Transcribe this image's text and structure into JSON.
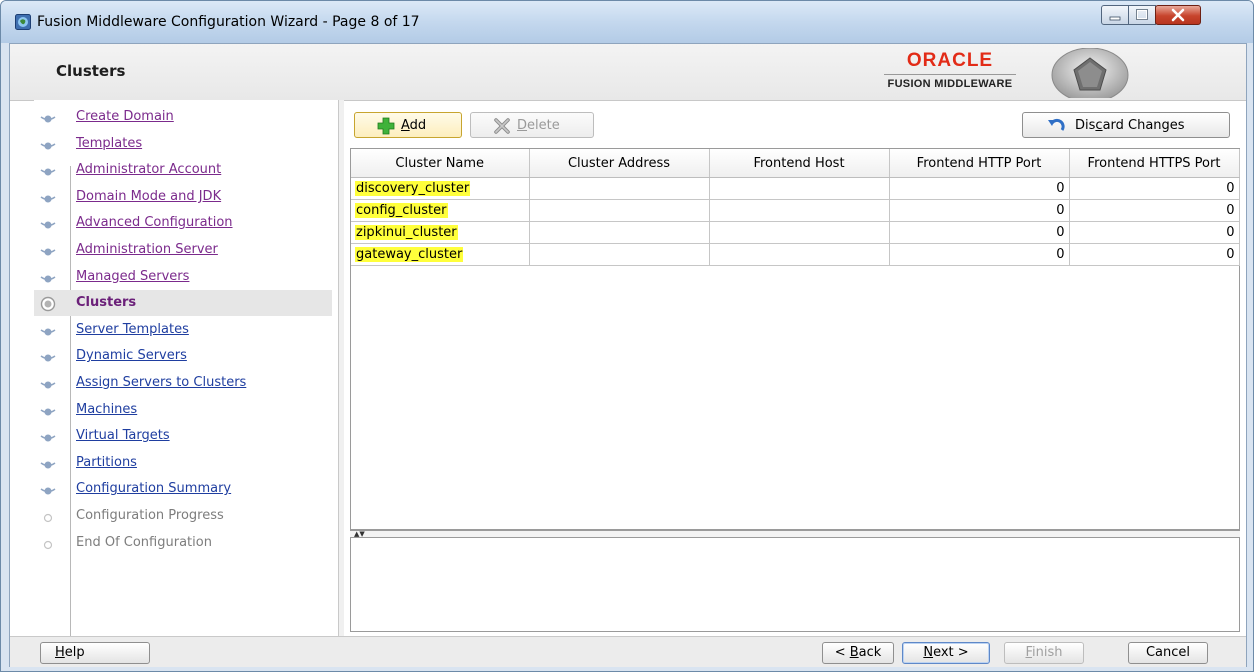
{
  "window": {
    "title": "Fusion Middleware Configuration Wizard - Page 8 of 17"
  },
  "header": {
    "heading": "Clusters",
    "brand": "ORACLE",
    "brand_sub": "FUSION MIDDLEWARE"
  },
  "nav": {
    "items": [
      {
        "label": "Create Domain",
        "state": "visited"
      },
      {
        "label": "Templates",
        "state": "visited"
      },
      {
        "label": "Administrator Account",
        "state": "visited"
      },
      {
        "label": "Domain Mode and JDK",
        "state": "visited"
      },
      {
        "label": "Advanced Configuration",
        "state": "visited"
      },
      {
        "label": "Administration Server",
        "state": "visited"
      },
      {
        "label": "Managed Servers",
        "state": "visited"
      },
      {
        "label": "Clusters",
        "state": "current"
      },
      {
        "label": "Server Templates",
        "state": "link"
      },
      {
        "label": "Dynamic Servers",
        "state": "link"
      },
      {
        "label": "Assign Servers to Clusters",
        "state": "link"
      },
      {
        "label": "Machines",
        "state": "link"
      },
      {
        "label": "Virtual Targets",
        "state": "link"
      },
      {
        "label": "Partitions",
        "state": "link"
      },
      {
        "label": "Configuration Summary",
        "state": "link"
      },
      {
        "label": "Configuration Progress",
        "state": "pending"
      },
      {
        "label": "End Of Configuration",
        "state": "pending"
      }
    ]
  },
  "toolbar": {
    "add": {
      "mn": "A",
      "rest": "dd"
    },
    "delete": {
      "mn": "D",
      "rest": "elete"
    },
    "discard": {
      "pre": "Dis",
      "mn": "c",
      "rest": "ard Changes"
    }
  },
  "table": {
    "columns": [
      "Cluster Name",
      "Cluster Address",
      "Frontend Host",
      "Frontend HTTP Port",
      "Frontend HTTPS Port"
    ],
    "rows": [
      {
        "name": "discovery_cluster",
        "address": "",
        "host": "",
        "http": "0",
        "https": "0"
      },
      {
        "name": "config_cluster",
        "address": "",
        "host": "",
        "http": "0",
        "https": "0"
      },
      {
        "name": "zipkinui_cluster",
        "address": "",
        "host": "",
        "http": "0",
        "https": "0"
      },
      {
        "name": "gateway_cluster",
        "address": "",
        "host": "",
        "http": "0",
        "https": "0"
      }
    ]
  },
  "footer": {
    "help": {
      "mn": "H",
      "rest": "elp"
    },
    "back": {
      "pre": "< ",
      "mn": "B",
      "rest": "ack"
    },
    "next": {
      "mn": "N",
      "rest": "ext >"
    },
    "finish": {
      "mn": "F",
      "rest": "inish"
    },
    "cancel": {
      "label": "Cancel"
    }
  },
  "colors": {
    "accent_highlight": "#ffff3b",
    "oracle_red": "#e22b17",
    "visited_link": "#7b2a8c",
    "unvisited_link": "#1f3ea0"
  }
}
